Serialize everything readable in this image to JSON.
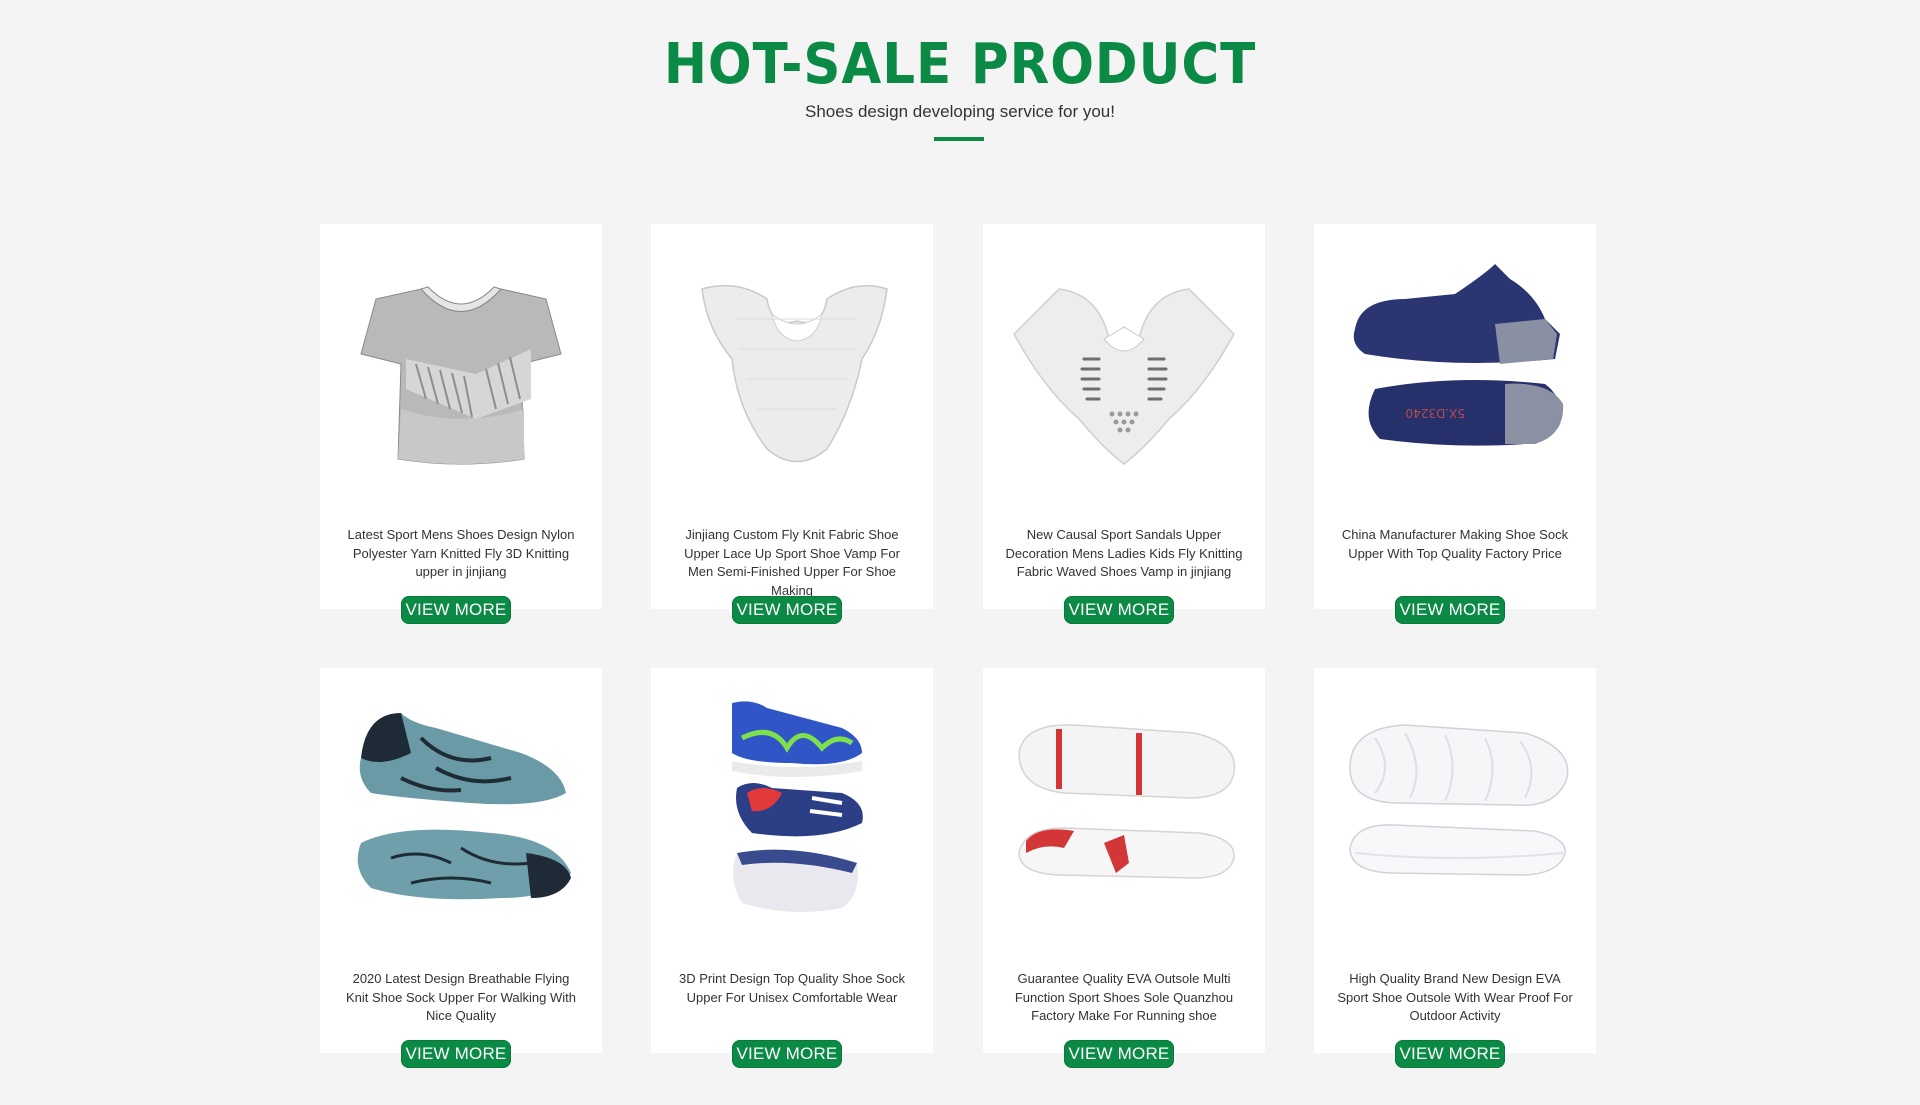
{
  "header": {
    "title": "HOT-SALE PRODUCT",
    "subtitle": "Shoes design developing service for you!"
  },
  "colors": {
    "accent": "#0b8a45",
    "background": "#f4f4f4",
    "card": "#ffffff"
  },
  "products": [
    {
      "image": "gray-knit-top-upper",
      "description": "Latest Sport Mens Shoes Design Nylon Polyester Yarn Knitted Fly 3D Knitting upper in jinjiang",
      "button": "VIEW MORE"
    },
    {
      "image": "white-knit-vamp",
      "description": "Jinjiang Custom Fly Knit Fabric Shoe Upper Lace Up Sport Shoe Vamp For Men Semi-Finished Upper For Shoe Making",
      "button": "VIEW MORE"
    },
    {
      "image": "white-wave-vamp",
      "description": "New Causal Sport Sandals Upper Decoration Mens Ladies Kids Fly Knitting Fabric Waved Shoes Vamp in jinjiang",
      "button": "VIEW MORE"
    },
    {
      "image": "navy-sock-upper",
      "description": "China Manufacturer Making Shoe Sock Upper With Top Quality Factory Price",
      "button": "VIEW MORE"
    },
    {
      "image": "blue-knit-sock-shoe",
      "description": "2020 Latest Design Breathable Flying Knit Shoe Sock Upper For Walking With Nice Quality",
      "button": "VIEW MORE"
    },
    {
      "image": "kids-sneakers-stack",
      "description": "3D Print Design Top Quality Shoe Sock Upper For Unisex Comfortable Wear",
      "button": "VIEW MORE"
    },
    {
      "image": "red-white-eva-outsole",
      "description": "Guarantee Quality EVA Outsole Multi Function Sport Shoes Sole Quanzhou Factory Make For Running shoe",
      "button": "VIEW MORE"
    },
    {
      "image": "white-eva-outsole",
      "description": "High Quality Brand New Design EVA Sport Shoe Outsole With Wear Proof For Outdoor Activity",
      "button": "VIEW MORE"
    }
  ]
}
